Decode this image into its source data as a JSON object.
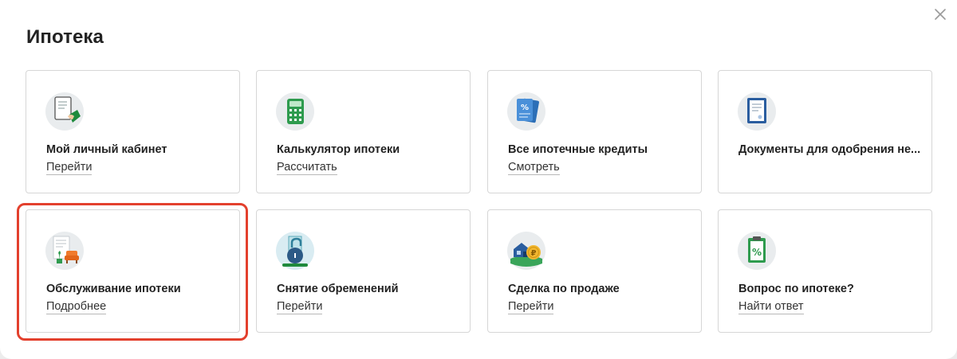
{
  "page": {
    "title": "Ипотека",
    "close_icon": "close-icon"
  },
  "cards": [
    {
      "title": "Мой личный кабинет",
      "action": "Перейти",
      "icon": "personal-cabinet-icon"
    },
    {
      "title": "Калькулятор ипотеки",
      "action": "Рассчитать",
      "icon": "calculator-icon"
    },
    {
      "title": "Все ипотечные кредиты",
      "action": "Смотреть",
      "icon": "mortgage-loans-icon"
    },
    {
      "title": "Документы для одобрения не...",
      "action": "",
      "icon": "documents-icon"
    },
    {
      "title": "Обслуживание ипотеки",
      "action": "Подробнее",
      "icon": "mortgage-service-icon"
    },
    {
      "title": "Снятие обременений",
      "action": "Перейти",
      "icon": "lock-release-icon"
    },
    {
      "title": "Сделка по продаже",
      "action": "Перейти",
      "icon": "house-sale-icon"
    },
    {
      "title": "Вопрос по ипотеке?",
      "action": "Найти ответ",
      "icon": "clipboard-percent-icon"
    }
  ],
  "colors": {
    "highlight": "#e3402d",
    "accent_green": "#21a038",
    "icon_bg": "#e9ecee"
  }
}
